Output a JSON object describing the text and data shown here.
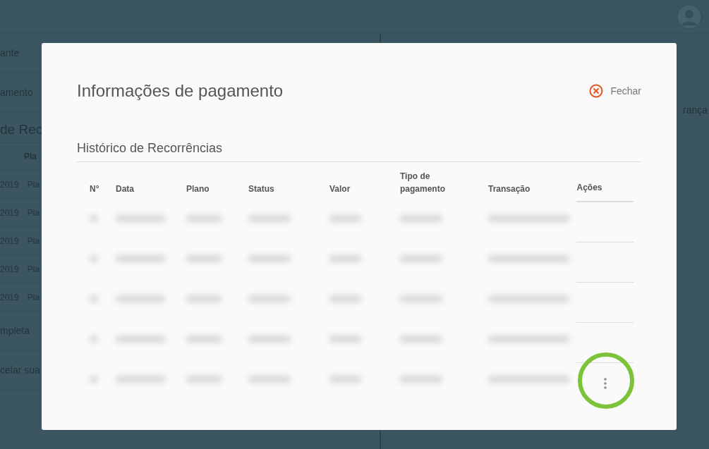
{
  "background_page": {
    "left_items": [
      {
        "kind": "text",
        "text": "ante"
      },
      {
        "kind": "text",
        "text": "amento"
      },
      {
        "kind": "heading",
        "text": "de Rec"
      },
      {
        "kind": "table_header",
        "text": "Pla"
      },
      {
        "kind": "table_row",
        "cells": [
          "2019",
          "Pla"
        ]
      },
      {
        "kind": "table_row",
        "cells": [
          "2019",
          "Pla"
        ]
      },
      {
        "kind": "table_row",
        "cells": [
          "2019",
          "Pla"
        ]
      },
      {
        "kind": "table_row",
        "cells": [
          "2019",
          "Pla"
        ]
      },
      {
        "kind": "table_row",
        "cells": [
          "2019",
          "Pla"
        ]
      },
      {
        "kind": "text",
        "text": "mpleta"
      },
      {
        "kind": "text",
        "text": "celar sua"
      }
    ],
    "right_text": "rança"
  },
  "modal": {
    "title": "Informações de pagamento",
    "close_label": "Fechar",
    "section_title": "Histórico de Recorrências",
    "columns": [
      "N°",
      "Data",
      "Plano",
      "Status",
      "Valor",
      "Tipo de pagamento",
      "Transação",
      "Ações"
    ],
    "rows": [
      {
        "has_menu": false,
        "highlighted": false
      },
      {
        "has_menu": false,
        "highlighted": false
      },
      {
        "has_menu": false,
        "highlighted": false
      },
      {
        "has_menu": false,
        "highlighted": false
      },
      {
        "has_menu": true,
        "highlighted": true
      }
    ]
  }
}
